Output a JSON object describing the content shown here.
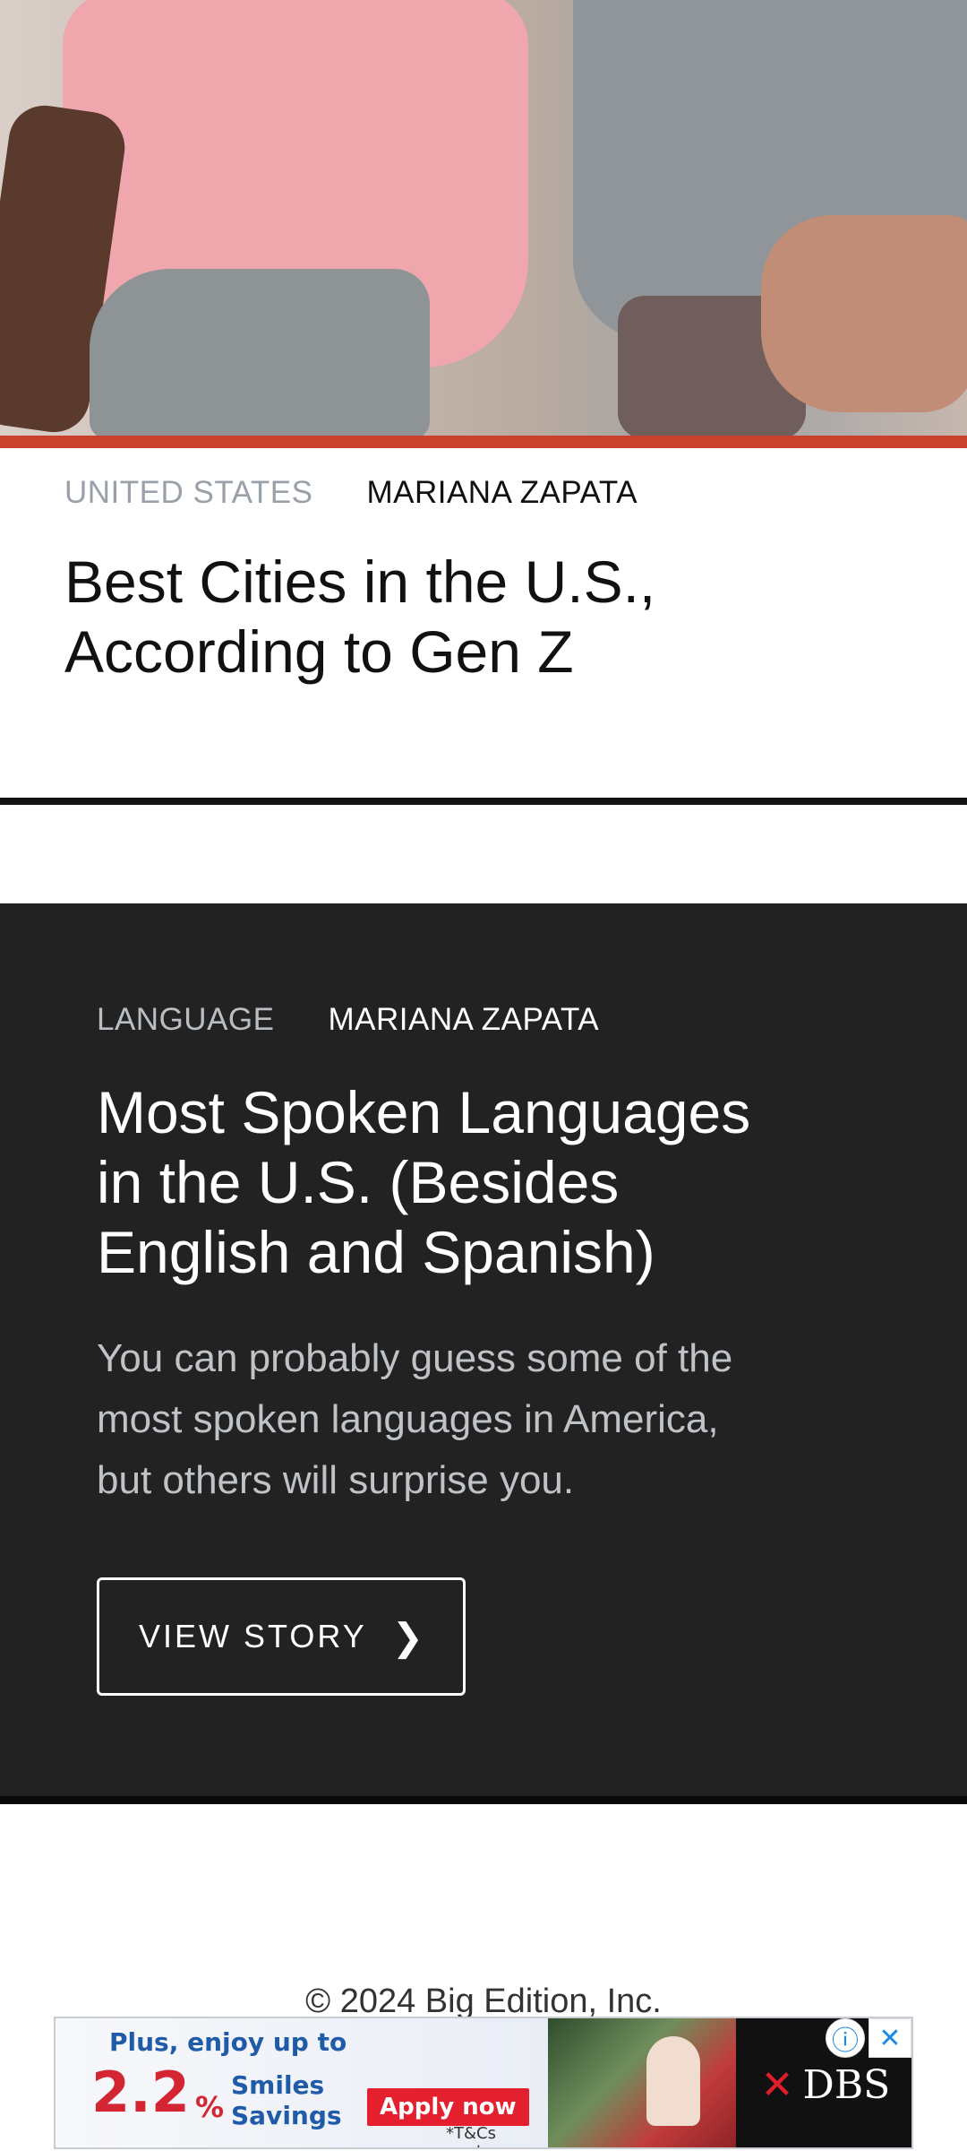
{
  "story1": {
    "category": "UNITED STATES",
    "author": "MARIANA ZAPATA",
    "title_line1": "Best Cities in the U.S.,",
    "title_line2": "According to Gen Z"
  },
  "story2": {
    "category": "LANGUAGE",
    "author": "MARIANA ZAPATA",
    "title_line1": "Most Spoken Languages",
    "title_line2": "in the U.S. (Besides",
    "title_line3": "English and Spanish)",
    "desc_line1": "You can probably guess some of the",
    "desc_line2": "most spoken languages in America,",
    "desc_line3": "but others will surprise you.",
    "button_label": "VIEW STORY",
    "button_icon": "❯"
  },
  "footer": {
    "copyright": "© 2024 Big Edition, Inc."
  },
  "ad": {
    "headline": "Plus, enjoy up to",
    "rate": "2.2",
    "percent": "%",
    "smiles_line1": "Smiles",
    "smiles_line2": "Savings",
    "apply_label": "Apply now",
    "tcs": "*T&Cs apply.",
    "brand": "DBS",
    "brand_mark": "✕",
    "info_icon": "ⓘ",
    "close_icon": "✕"
  },
  "colors": {
    "accent_red": "#c9412d",
    "dark_panel": "#222222",
    "ad_red": "#d32632",
    "ad_blue": "#1f5ba8"
  }
}
